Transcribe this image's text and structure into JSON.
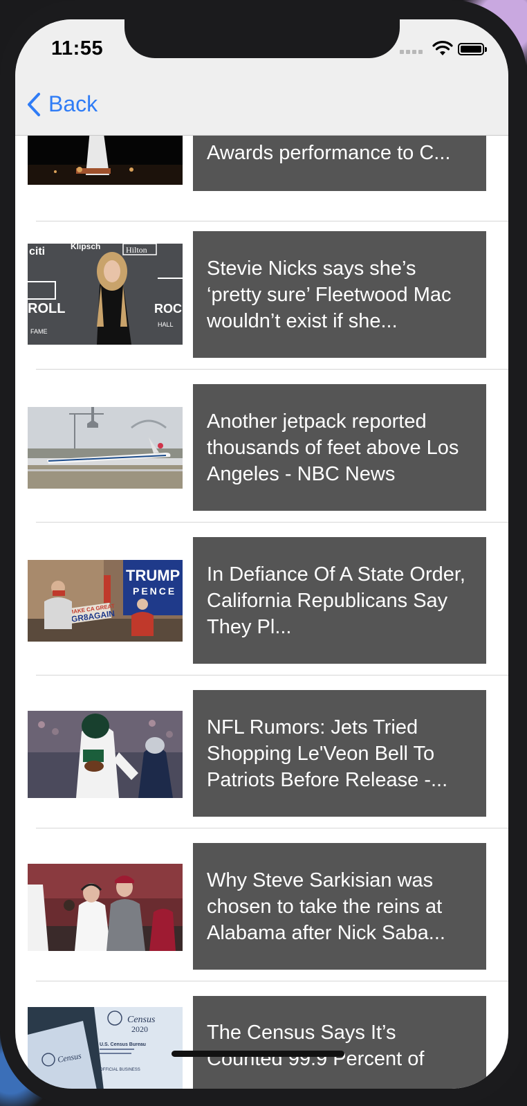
{
  "status": {
    "time": "11:55"
  },
  "nav": {
    "back_label": "Back"
  },
  "articles": [
    {
      "title": "emotional Billboard Music Awards performance to C..."
    },
    {
      "title": "Stevie Nicks says she’s ‘pretty sure’ Fleetwood Mac wouldn’t exist if she..."
    },
    {
      "title": "Another jetpack reported thousands of feet above Los Angeles - NBC News"
    },
    {
      "title": "In Defiance Of A State Order, California Republicans Say They Pl..."
    },
    {
      "title": "NFL Rumors: Jets Tried Shopping Le'Veon Bell To Patriots Before Release -..."
    },
    {
      "title": "Why Steve Sarkisian was chosen to take the reins at Alabama after Nick Saba..."
    },
    {
      "title": "The Census Says It’s Counted 99.9 Percent of"
    }
  ],
  "thumbnails": {
    "row1_sign_text": [
      "citi",
      "Klipsch",
      "Hilton",
      "ROLL",
      "ROCK",
      "FAME",
      "HALL"
    ],
    "row3_sign_text": [
      "TRUMP",
      "PENCE",
      "MAKE CA GREAT",
      "GR8AGAIN"
    ],
    "row6_sign_text": [
      "Census",
      "2020",
      "U.S. Census Bureau",
      "OFFICIAL BUSINESS"
    ]
  },
  "colors": {
    "accent": "#2f7cf6",
    "card": "#555555",
    "nav": "#efefef"
  }
}
